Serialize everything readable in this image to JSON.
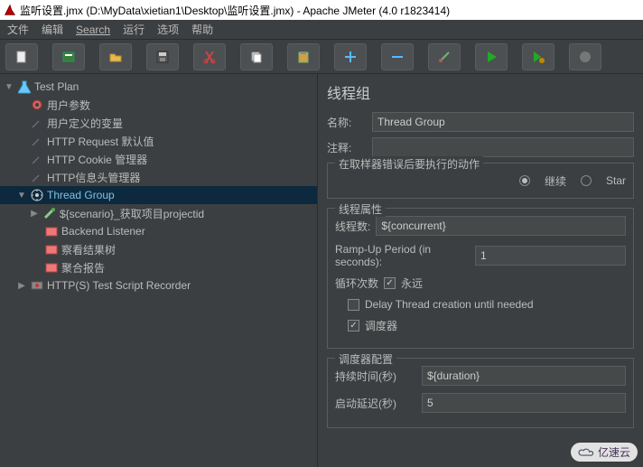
{
  "window": {
    "title": "监听设置.jmx (D:\\MyData\\xietian1\\Desktop\\监听设置.jmx) - Apache JMeter (4.0 r1823414)"
  },
  "menu": {
    "file": "文件",
    "edit": "编辑",
    "search": "Search",
    "run": "运行",
    "options": "选项",
    "help": "帮助"
  },
  "tree": {
    "testplan": "Test Plan",
    "userparams": "用户参数",
    "uservars": "用户定义的变量",
    "httpreq": "HTTP Request 默认值",
    "httpcookie": "HTTP Cookie 管理器",
    "httpheader": "HTTP信息头管理器",
    "threadgroup": "Thread Group",
    "scenario": "${scenario}_获取项目projectid",
    "backend": "Backend Listener",
    "resultstree": "察看结果树",
    "aggregate": "聚合报告",
    "recorder": "HTTP(S) Test Script Recorder"
  },
  "panel": {
    "heading": "线程组",
    "name_label": "名称:",
    "name_value": "Thread Group",
    "comment_label": "注释:",
    "comment_value": "",
    "onerror_legend": "在取样器错误后要执行的动作",
    "radio_continue": "继续",
    "radio_start": "Star",
    "props_legend": "线程属性",
    "threads_label": "线程数:",
    "threads_value": "${concurrent}",
    "rampup_label": "Ramp-Up Period (in seconds):",
    "rampup_value": "1",
    "loop_label": "循环次数",
    "loop_forever": "永远",
    "delay_label": "Delay Thread creation until needed",
    "scheduler_label": "调度器",
    "sched_legend": "调度器配置",
    "duration_label": "持续时间(秒)",
    "duration_value": "${duration}",
    "delay_start_label": "启动延迟(秒)",
    "delay_start_value": "5"
  },
  "watermark": "亿速云"
}
